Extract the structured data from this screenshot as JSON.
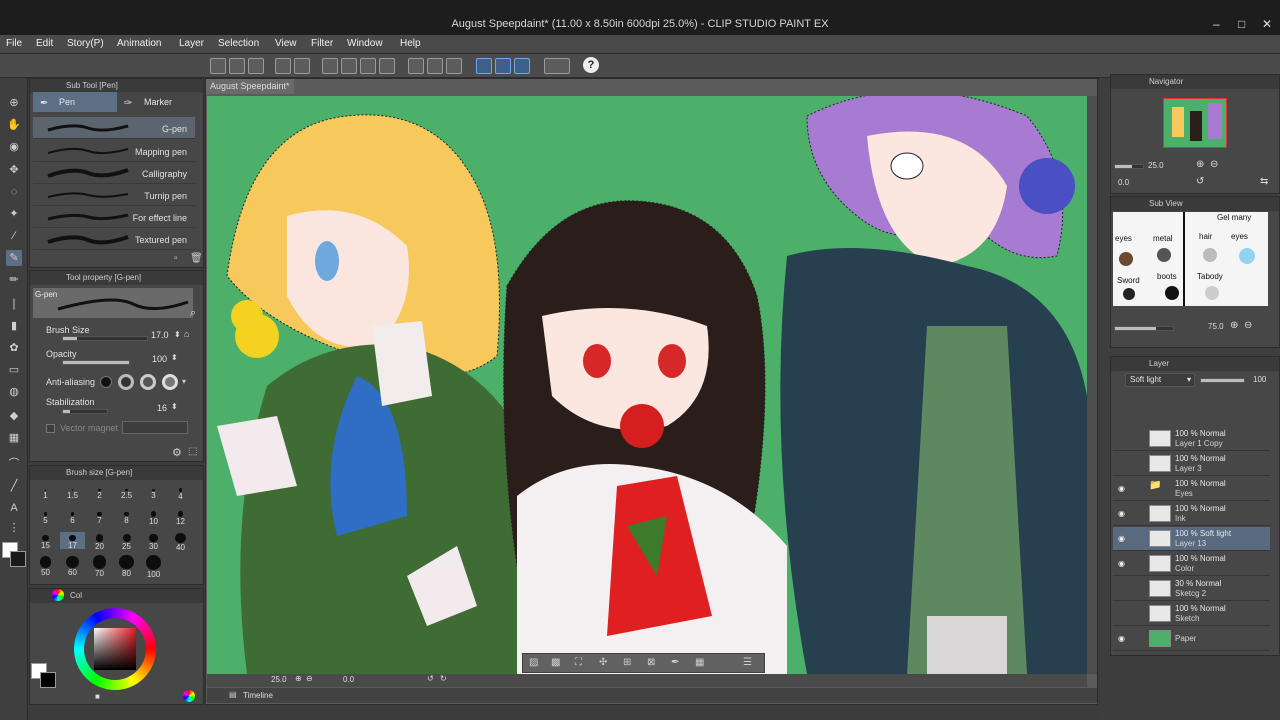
{
  "window": {
    "title": "August Speepdaint* (11.00 x 8.50in 600dpi 25.0%) - CLIP STUDIO PAINT EX",
    "controls": [
      "–",
      "□",
      "✕"
    ]
  },
  "menu": [
    "File",
    "Edit",
    "Story(P)",
    "Animation",
    "Layer",
    "Selection",
    "View",
    "Filter",
    "Window",
    "Help"
  ],
  "command_bar": {
    "help_label": "?"
  },
  "subtool": {
    "header": "Sub Tool [Pen]",
    "tabs": [
      "Pen",
      "Marker"
    ],
    "brushes": [
      "G-pen",
      "Mapping pen",
      "Calligraphy",
      "Turnip pen",
      "For effect line",
      "Textured pen"
    ]
  },
  "tool_property": {
    "header": "Tool property [G-pen]",
    "preview_label": "G-pen",
    "brush_size_label": "Brush Size",
    "brush_size_value": "17.0",
    "opacity_label": "Opacity",
    "opacity_value": "100",
    "antialias_label": "Anti-aliasing",
    "stabilization_label": "Stabilization",
    "stabilization_value": "16",
    "vector_magnet_label": "Vector magnet",
    "brush_size_fraction": 0.17,
    "opacity_fraction": 1.0,
    "stabilization_fraction": 0.16
  },
  "brush_size_panel": {
    "header": "Brush size [G-pen]",
    "sizes": [
      "1",
      "1.5",
      "2",
      "2.5",
      "3",
      "4",
      "5",
      "6",
      "7",
      "8",
      "10",
      "12",
      "15",
      "17",
      "20",
      "25",
      "30",
      "40",
      "50",
      "60",
      "70",
      "80",
      "100"
    ]
  },
  "color_panel": {
    "header": "Col"
  },
  "document": {
    "tab": "August Speepdaint*",
    "zoom": "25.0",
    "rotation": "0.0",
    "canvas_color": "#4caf6a"
  },
  "timeline": {
    "label": "Timeline"
  },
  "navigator": {
    "header": "Navigator",
    "zoom": "25.0",
    "rotation": "0.0"
  },
  "subview": {
    "header": "Sub View",
    "zoom": "75.0",
    "labels": [
      "Gel many",
      "eyes",
      "metal",
      "hair",
      "eyes",
      "Sword",
      "boots",
      "Tabody"
    ]
  },
  "layers": {
    "header": "Layer",
    "blend_mode": "Soft light",
    "opacity": "100",
    "items": [
      {
        "pct": "100 %",
        "mode": "Normal",
        "name": "Layer 1 Copy",
        "visible": false,
        "selected": false
      },
      {
        "pct": "100 %",
        "mode": "Normal",
        "name": "Layer 3",
        "visible": false,
        "selected": false
      },
      {
        "pct": "100 %",
        "mode": "Normal",
        "name": "Eyes",
        "visible": true,
        "selected": false,
        "folder": true
      },
      {
        "pct": "100 %",
        "mode": "Normal",
        "name": "Ink",
        "visible": true,
        "selected": false
      },
      {
        "pct": "100 %",
        "mode": "Soft light",
        "name": "Layer 13",
        "visible": true,
        "selected": true
      },
      {
        "pct": "100 %",
        "mode": "Normal",
        "name": "Color",
        "visible": true,
        "selected": false
      },
      {
        "pct": "30 %",
        "mode": "Normal",
        "name": "Sketcg 2",
        "visible": false,
        "selected": false
      },
      {
        "pct": "100 %",
        "mode": "Normal",
        "name": "Sketch",
        "visible": false,
        "selected": false
      },
      {
        "pct": "",
        "mode": "",
        "name": "Paper",
        "visible": true,
        "selected": false,
        "paper": true
      }
    ]
  }
}
